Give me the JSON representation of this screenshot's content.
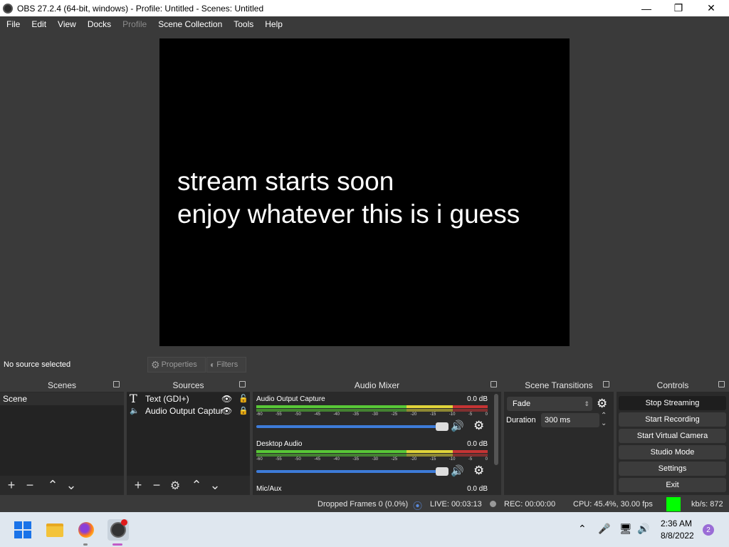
{
  "window": {
    "title": "OBS 27.2.4 (64-bit, windows) - Profile: Untitled - Scenes: Untitled"
  },
  "menu": {
    "items": [
      "File",
      "Edit",
      "View",
      "Docks",
      "Profile",
      "Scene Collection",
      "Tools",
      "Help"
    ]
  },
  "preview": {
    "line1": "stream starts soon",
    "line2": "enjoy whatever this is i guess"
  },
  "source_bar": {
    "no_source": "No source selected",
    "properties": "Properties",
    "filters": "Filters"
  },
  "scenes": {
    "title": "Scenes",
    "items": [
      "Scene"
    ]
  },
  "sources": {
    "title": "Sources",
    "items": [
      "Text (GDI+)",
      "Audio Output Captur"
    ]
  },
  "mixer": {
    "title": "Audio Mixer",
    "tick_labels": [
      "-60",
      "-55",
      "-50",
      "-45",
      "-40",
      "-35",
      "-30",
      "-25",
      "-20",
      "-15",
      "-10",
      "-5",
      "0"
    ],
    "channels": [
      {
        "name": "Audio Output Capture",
        "db": "0.0 dB"
      },
      {
        "name": "Desktop Audio",
        "db": "0.0 dB"
      },
      {
        "name": "Mic/Aux",
        "db": "0.0 dB"
      }
    ]
  },
  "transitions": {
    "title": "Scene Transitions",
    "selected": "Fade",
    "duration_label": "Duration",
    "duration_value": "300 ms"
  },
  "controls": {
    "title": "Controls",
    "buttons": [
      "Stop Streaming",
      "Start Recording",
      "Start Virtual Camera",
      "Studio Mode",
      "Settings",
      "Exit"
    ]
  },
  "status": {
    "dropped": "Dropped Frames 0 (0.0%)",
    "live": "LIVE: 00:03:13",
    "rec": "REC: 00:00:00",
    "cpu": "CPU: 45.4%, 30.00 fps",
    "kbs": "kb/s: 872"
  },
  "taskbar": {
    "time": "2:36 AM",
    "date": "8/8/2022",
    "notifications": "2"
  },
  "colors": {
    "accent": "#3d7bd8",
    "stream_indicator": "#00ff00"
  }
}
